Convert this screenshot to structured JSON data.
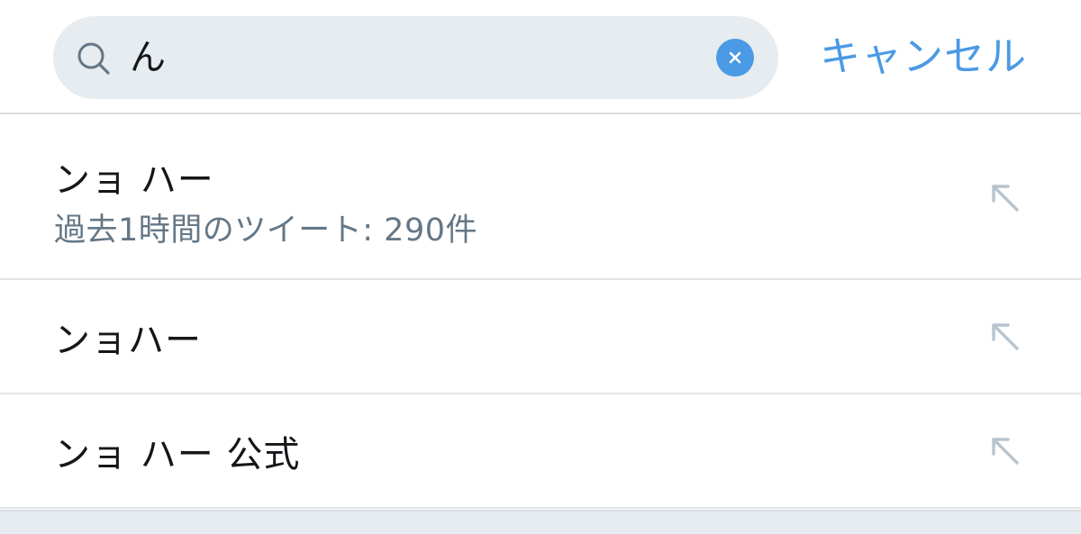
{
  "search": {
    "query": "ん",
    "placeholder": "",
    "cancel_label": "キャンセル"
  },
  "suggestions": [
    {
      "title": "ンョ ハー",
      "subtitle": "過去1時間のツイート: 290件"
    },
    {
      "title": "ンョハー"
    },
    {
      "title": "ンョ ハー 公式"
    }
  ],
  "colors": {
    "accent": "#4a9ae5",
    "search_field_bg": "#e6ecf0",
    "primary_text": "#14171a",
    "secondary_text": "#657786",
    "divider": "#e1e5e8",
    "arrow_icon": "#b8c4cd"
  },
  "icons": {
    "search": "search-icon",
    "clear": "clear-icon",
    "fill_query": "arrow-up-left-icon"
  }
}
